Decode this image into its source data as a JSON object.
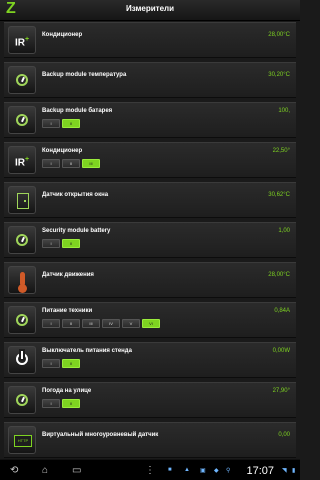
{
  "header": {
    "title": "Измерители",
    "logo": "Z"
  },
  "rows": [
    {
      "icon": "ir-icon",
      "name": "Кондиционер",
      "value": "28,00°C"
    },
    {
      "icon": "gauge-icon",
      "name": "Backup module температура",
      "value": "30,20°C"
    },
    {
      "icon": "gauge-icon",
      "name": "Backup module батарея",
      "value": "100,",
      "buttons": [
        "I",
        "II"
      ],
      "active": 1
    },
    {
      "icon": "ir-icon",
      "name": "Кондиционер",
      "value": "22,50°",
      "buttons": [
        "I",
        "II",
        "III"
      ],
      "active": 2
    },
    {
      "icon": "door-icon",
      "name": "Датчик открытия окна",
      "value": "30,62°C"
    },
    {
      "icon": "gauge-icon",
      "name": "Security module battery",
      "value": "1,00",
      "buttons": [
        "I",
        "II"
      ],
      "active": 1
    },
    {
      "icon": "thermometer-icon",
      "name": "Датчик движения",
      "value": "28,00°C"
    },
    {
      "icon": "gauge-icon",
      "name": "Питание техники",
      "value": "0,84A",
      "buttons": [
        "I",
        "II",
        "III",
        "IV",
        "V",
        "VI"
      ],
      "active": 5
    },
    {
      "icon": "power-icon",
      "name": "Выключатель питания стенда",
      "value": "0,00W",
      "buttons": [
        "I",
        "II"
      ],
      "active": 1
    },
    {
      "icon": "gauge-icon",
      "name": "Погода на улице",
      "value": "27,90°",
      "buttons": [
        "I",
        "II"
      ],
      "active": 1
    },
    {
      "icon": "http-icon",
      "name": "Виртуальный многоуровневый датчик",
      "value": "0,00"
    }
  ],
  "navbar": {
    "time": "17:07",
    "back": "back-icon",
    "home": "home-icon",
    "recent": "recent-apps-icon"
  },
  "colors": {
    "accent": "#7ed321",
    "background": "#1a1a1a"
  }
}
